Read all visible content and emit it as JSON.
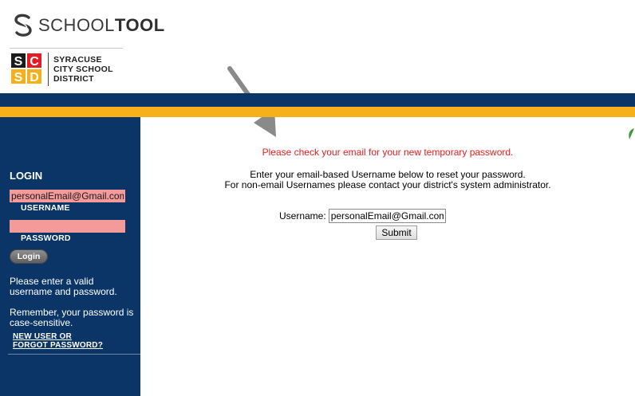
{
  "header": {
    "app_brand_light": "SCHOOL",
    "app_brand_bold": "TOOL",
    "district_line1": "SYRACUSE",
    "district_line2": "CITY SCHOOL",
    "district_line3": "DISTRICT",
    "district_logo_letters": [
      "S",
      "C",
      "S",
      "D"
    ]
  },
  "colors": {
    "navy": "#0a3566",
    "gold": "#f5b01a",
    "error_red": "#ee1c1c",
    "field_error_pink": "#f59a9a"
  },
  "sidebar": {
    "title": "LOGIN",
    "username_value": "personalEmail@Gmail.com",
    "username_label": "USERNAME",
    "password_value": "",
    "password_label": "PASSWORD",
    "login_button": "Login",
    "error_message": "Please enter a valid username and password.",
    "case_note": "Remember, your password is case-sensitive.",
    "forgot_line1": "NEW USER OR",
    "forgot_line2": "FORGOT PASSWORD?"
  },
  "main": {
    "notice": "Please check your email for your new temporary password.",
    "instruction_line1": "Enter your email-based Username below to reset your password.",
    "instruction_line2": "For non-email Usernames please contact your district's system administrator.",
    "username_label": "Username:",
    "username_value": "personalEmail@Gmail.com",
    "submit_button": "Submit"
  },
  "icons": [
    "schooltool-logo-icon",
    "scsd-logo-icon",
    "annotation-arrow-icon",
    "leaf-icon"
  ]
}
